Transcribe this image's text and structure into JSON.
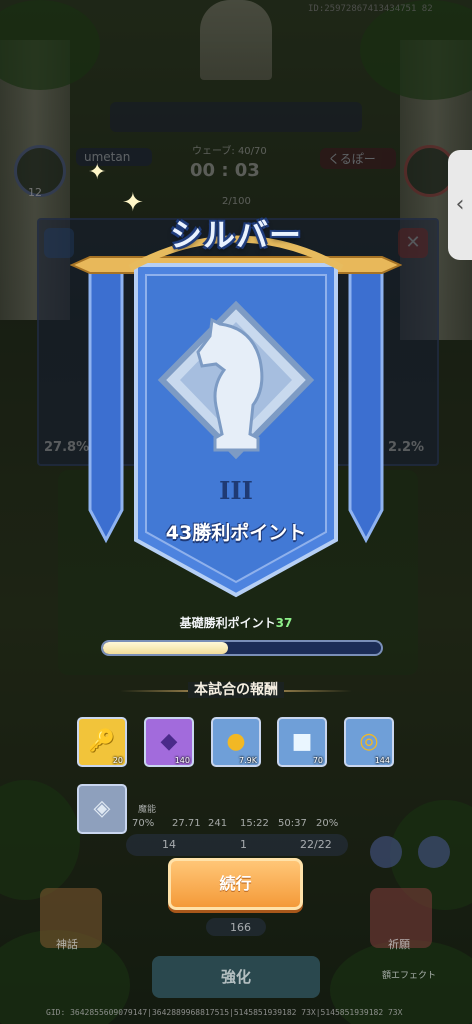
{
  "top": {
    "id_text": "ID:25972867413434751 82"
  },
  "players": {
    "left_name": "umetan",
    "left_level": "12",
    "right_name": "くるぽー"
  },
  "wave": {
    "label": "ウェーブ: 40/70",
    "timer": "00 : 03",
    "count": "2/100"
  },
  "arena": {
    "left_percent": "27.8%",
    "right_percent": "2.2%"
  },
  "result": {
    "title": "シルバー",
    "rank_numeral": "III",
    "points_label": "43勝利ポイント",
    "base_label": "基礎勝利ポイント",
    "base_value": "37",
    "progress_fraction": 0.45
  },
  "rewards": {
    "title": "本試合の報酬",
    "items": [
      {
        "name": "key-item",
        "count": "20",
        "color": "#f2c43a"
      },
      {
        "name": "purple-crystal-item",
        "count": "140",
        "color": "#a26bdc"
      },
      {
        "name": "gold-coin-item",
        "count": "7.9K",
        "color": "#6f9fd8"
      },
      {
        "name": "ice-cube-item",
        "count": "70",
        "color": "#6f9fd8"
      },
      {
        "name": "coin-stack-item",
        "count": "144",
        "color": "#6f9fd8"
      },
      {
        "name": "silver-ore-item",
        "count": "",
        "color": "#8ea0bd"
      }
    ]
  },
  "stats": {
    "s1": "70%",
    "s2": "27.71",
    "s3": "241",
    "s4": "15:22",
    "s5": "50:37",
    "s6": "20%",
    "c1": "14",
    "c2": "1",
    "c3": "22/22",
    "low_label": "魔能",
    "card_count": "166"
  },
  "buttons": {
    "continue": "続行",
    "enhance": "強化",
    "myth": "神話",
    "pray": "祈願",
    "effect": "額エフェクト"
  },
  "bottom": {
    "gid_text": "GID: 3642855609079147|3642889968817515|5145851939182 73X|5145851939182 73X"
  }
}
